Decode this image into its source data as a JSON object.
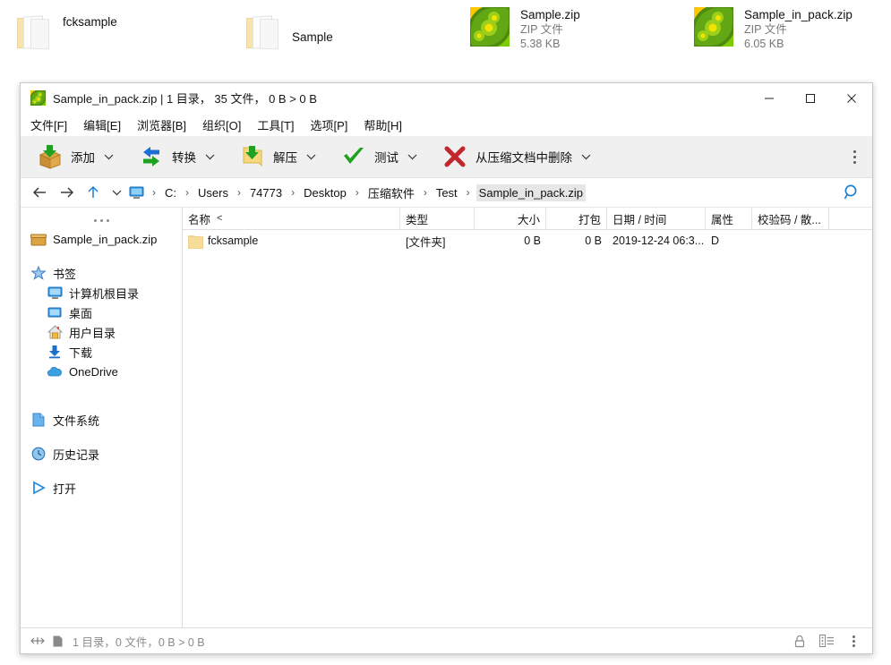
{
  "desktop": {
    "items": [
      {
        "name": "fcksample",
        "kind": "folder",
        "subtype": "",
        "size": "",
        "icon": "folder-icon"
      },
      {
        "name": "Sample",
        "kind": "folder",
        "subtype": "",
        "size": "",
        "icon": "folder-icon"
      },
      {
        "name": "Sample.zip",
        "kind": "zip",
        "subtype": "ZIP 文件",
        "size": "5.38 KB",
        "icon": "peazip-archive-icon"
      },
      {
        "name": "Sample_in_pack.zip",
        "kind": "zip",
        "subtype": "ZIP 文件",
        "size": "6.05 KB",
        "icon": "peazip-archive-icon"
      }
    ]
  },
  "window": {
    "title": "Sample_in_pack.zip | 1 目录， 35 文件， 0 B > 0 B",
    "app_icon": "peazip-icon",
    "controls": {
      "minimize": "—",
      "maximize": "□",
      "close": "✕"
    }
  },
  "menubar": {
    "items": [
      "文件[F]",
      "编辑[E]",
      "浏览器[B]",
      "组织[O]",
      "工具[T]",
      "选项[P]",
      "帮助[H]"
    ]
  },
  "toolbar": {
    "buttons": [
      {
        "label": "添加",
        "icon": "add-box-icon",
        "has_caret": true
      },
      {
        "label": "转换",
        "icon": "convert-arrows-icon",
        "has_caret": true
      },
      {
        "label": "解压",
        "icon": "extract-folder-icon",
        "has_caret": true
      },
      {
        "label": "测试",
        "icon": "test-check-icon",
        "has_caret": true
      },
      {
        "label": "从压缩文档中删除",
        "icon": "delete-x-icon",
        "has_caret": true
      }
    ],
    "overflow_icon": "more-vertical-icon"
  },
  "addressbar": {
    "back_icon": "arrow-left-icon",
    "forward_icon": "arrow-right-icon",
    "up_icon": "arrow-up-icon",
    "history_caret_icon": "chevron-down-icon",
    "root_icon": "computer-monitor-icon",
    "separator": "›",
    "crumbs": [
      "C:",
      "Users",
      "74773",
      "Desktop",
      "压缩软件",
      "Test",
      "Sample_in_pack.zip"
    ],
    "current_index": 6,
    "search_icon": "search-icon"
  },
  "sidebar": {
    "overflow_icon": "more-horizontal-icon",
    "archive": {
      "label": "Sample_in_pack.zip",
      "icon": "archive-box-icon"
    },
    "bookmarks": {
      "label": "书签",
      "icon": "star-icon",
      "items": [
        {
          "label": "计算机根目录",
          "icon": "computer-monitor-icon"
        },
        {
          "label": "桌面",
          "icon": "desktop-screen-icon"
        },
        {
          "label": "用户目录",
          "icon": "home-icon"
        },
        {
          "label": "下载",
          "icon": "download-icon"
        },
        {
          "label": "OneDrive",
          "icon": "cloud-icon"
        }
      ]
    },
    "sections": [
      {
        "label": "文件系统",
        "icon": "file-system-icon"
      },
      {
        "label": "历史记录",
        "icon": "clock-icon"
      },
      {
        "label": "打开",
        "icon": "play-icon"
      }
    ]
  },
  "filelist": {
    "columns": [
      {
        "key": "name",
        "label": "名称",
        "sort": "<"
      },
      {
        "key": "type",
        "label": "类型",
        "sort": ""
      },
      {
        "key": "size",
        "label": "大小",
        "sort": ""
      },
      {
        "key": "packed",
        "label": "打包",
        "sort": ""
      },
      {
        "key": "date",
        "label": "日期 / 时间",
        "sort": ""
      },
      {
        "key": "attr",
        "label": "属性",
        "sort": ""
      },
      {
        "key": "hash",
        "label": "校验码 / 散...",
        "sort": ""
      }
    ],
    "rows": [
      {
        "icon": "folder-icon",
        "name": "fcksample",
        "type": "[文件夹]",
        "size": "0 B",
        "packed": "0 B",
        "date": "2019-12-24 06:3...",
        "attr": "D",
        "hash": ""
      }
    ]
  },
  "statusbar": {
    "resize_icon": "resize-horizontal-icon",
    "page_icon": "page-icon",
    "text": "1 目录，0 文件，0 B > 0 B",
    "lock_icon": "lock-icon",
    "view_icon": "details-view-icon",
    "menu_icon": "more-vertical-icon"
  },
  "colors": {
    "accent": "#0078d7",
    "toolbar_bg": "#f0f0f0",
    "window_border": "#c8c8c8",
    "status_text": "#8a8a8a",
    "folder_yellow": "#f8dd9a",
    "pea_green": "#62a714",
    "delete_red": "#c1272d"
  }
}
